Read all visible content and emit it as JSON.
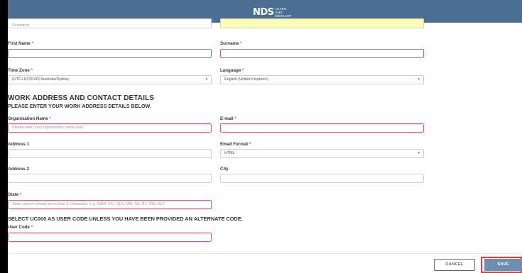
{
  "header": {
    "logo_mark": "NDS",
    "logo_line1": "LEARN",
    "logo_line2": "AND",
    "logo_line3": "DEVELOP"
  },
  "fields": {
    "top_left_partial": "Username",
    "first_name": {
      "label": "First Name",
      "value": ""
    },
    "surname": {
      "label": "Surname",
      "value": ""
    },
    "time_zone": {
      "label": "Time Zone",
      "value": "(UTC+10:00:00) Australia/Sydney"
    },
    "language": {
      "label": "Language",
      "value": "English (United Kingdom)"
    },
    "organisation_name": {
      "label": "Organisation Name",
      "placeholder": "Please enter your organisation name here."
    },
    "email": {
      "label": "E-mail",
      "value": ""
    },
    "address1": {
      "label": "Address 1",
      "value": ""
    },
    "email_format": {
      "label": "Email Format",
      "value": "HTML"
    },
    "address2": {
      "label": "Address 2",
      "value": ""
    },
    "city": {
      "label": "City",
      "value": ""
    },
    "state": {
      "label": "State",
      "placeholder": "State cannot contain more than 3 characters. e.g. NSW, VIC, QLD, WA, SA, NT, TAS, ACT"
    },
    "user_code": {
      "label": "User Code",
      "value": ""
    }
  },
  "required_marker": "*",
  "sections": {
    "work_title": "WORK ADDRESS AND CONTACT DETAILS",
    "work_subtitle": "PLEASE ENTER YOUR WORK ADDRESS DETAILS BELOW.",
    "user_code_note": "SELECT UC000 AS USER CODE UNLESS YOU HAVE BEEN PROVIDED AN ALTERNATE CODE."
  },
  "buttons": {
    "cancel": "CANCEL",
    "save": "SAVE"
  },
  "icons": {
    "dropdown": "▾"
  },
  "colors": {
    "header": "#4a6f93",
    "required": "#e05050",
    "invalid_border": "#e05d6f",
    "save_button": "#6f8fb0",
    "highlight_field": "#fbfdb8"
  }
}
